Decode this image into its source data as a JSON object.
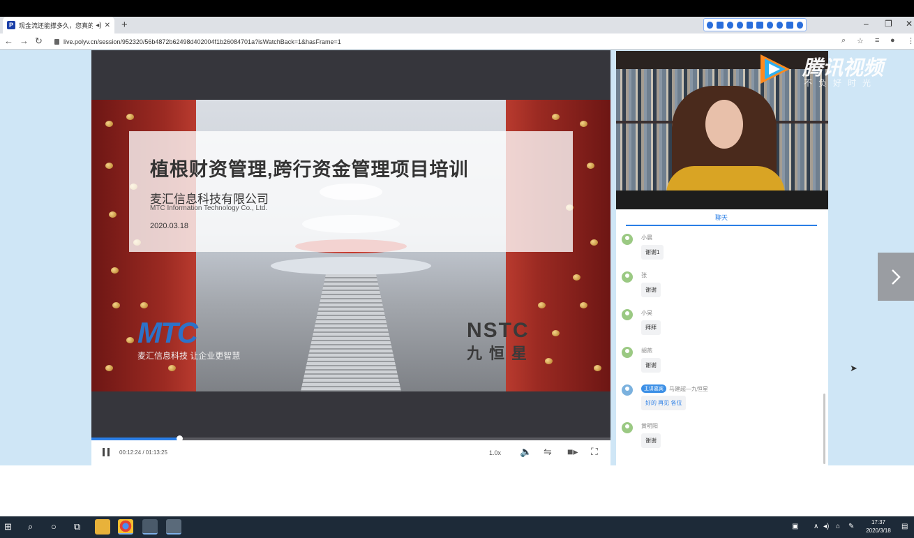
{
  "browser": {
    "tab_title": "现金流还能撑多久，您真的…",
    "tab_favicon": "P",
    "new_tab_icon": "+",
    "url": "live.polyv.cn/session/952320/56b4872b62498d402004f1b26084701a?isWatchBack=1&hasFrame=1",
    "window": {
      "minimize": "–",
      "restore": "❐",
      "close": "✕"
    }
  },
  "slide": {
    "title": "植根财资管理,跨行资金管理项目培训",
    "company_cn": "麦汇信息科技有限公司",
    "company_en": "MTC Information Technology Co., Ltd.",
    "date": "2020.03.18",
    "logo_left": "MTC",
    "logo_left_sub": "麦汇信息科技 让企业更智慧",
    "logo_right": "NSTC",
    "logo_right_sub": "九恒星"
  },
  "player": {
    "time": "00:12:24 / 01:13:25",
    "progress": 0.169,
    "speed": "1.0x",
    "icons": [
      "pause-icon",
      "volume-icon",
      "signal-icon",
      "camera-icon",
      "fullscreen-icon"
    ]
  },
  "watermark": {
    "title": "腾讯视频",
    "slogan": "不负好时光"
  },
  "chat": {
    "tab_label": "聊天",
    "messages": [
      {
        "name": "小晨",
        "text": "谢谢1",
        "badge": ""
      },
      {
        "name": "张",
        "text": "谢谢",
        "badge": ""
      },
      {
        "name": "小昊",
        "text": "拜拜",
        "badge": ""
      },
      {
        "name": "胡燕",
        "text": "谢谢",
        "badge": ""
      },
      {
        "name": "马建超—九恒星",
        "text": "好的 再见 各位",
        "badge": "主讲嘉宾"
      },
      {
        "name": "黄明阳",
        "text": "谢谢",
        "badge": ""
      }
    ]
  },
  "taskbar": {
    "clock_time": "17:37",
    "clock_date": "2020/3/18"
  },
  "colors": {
    "accent": "#2a7ee6",
    "page_bg": "#cfe6f6",
    "player_bg": "#36363c",
    "taskbar": "#1d2a38"
  }
}
